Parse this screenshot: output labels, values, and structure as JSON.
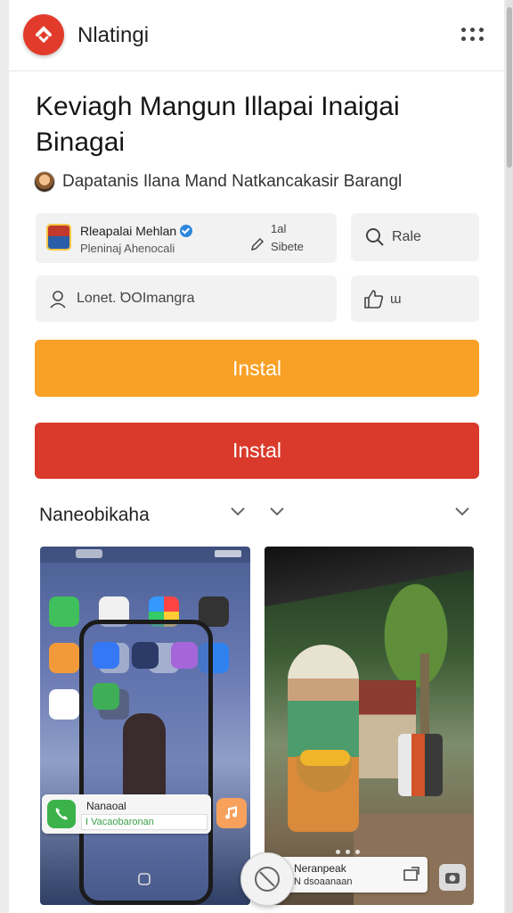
{
  "app": {
    "name": "Nlatingi"
  },
  "listing": {
    "title": "Keviagh Mangun Illapai  Inaigai Binagai",
    "subtitle": "Dapatanis  Ilana Mand Natkancakasir Barangl"
  },
  "developer_card": {
    "name": "Rleapalai Mehlan",
    "sub": "Pleninaj Ahenocali",
    "stat_value": "1al",
    "stat_label": "Sibete"
  },
  "rate_card": {
    "label": "Rale"
  },
  "lang_card": {
    "label": "Lonet.  ̛OOImangra"
  },
  "like_card": {
    "label": "ɯ"
  },
  "buttons": {
    "install_primary": "Instal",
    "install_secondary": "Instal"
  },
  "section": {
    "title": "Naneobikaha"
  },
  "screenshot_1": {
    "notif_title": "Nanaoal",
    "notif_sub": "I Vacaobaronan"
  },
  "screenshot_2": {
    "notif_title": "Neranpeak",
    "notif_sub": "N dsoaanaan"
  },
  "colors": {
    "install_primary": "#f9a126",
    "install_secondary": "#d93a2b",
    "logo": "#e23b2b"
  }
}
